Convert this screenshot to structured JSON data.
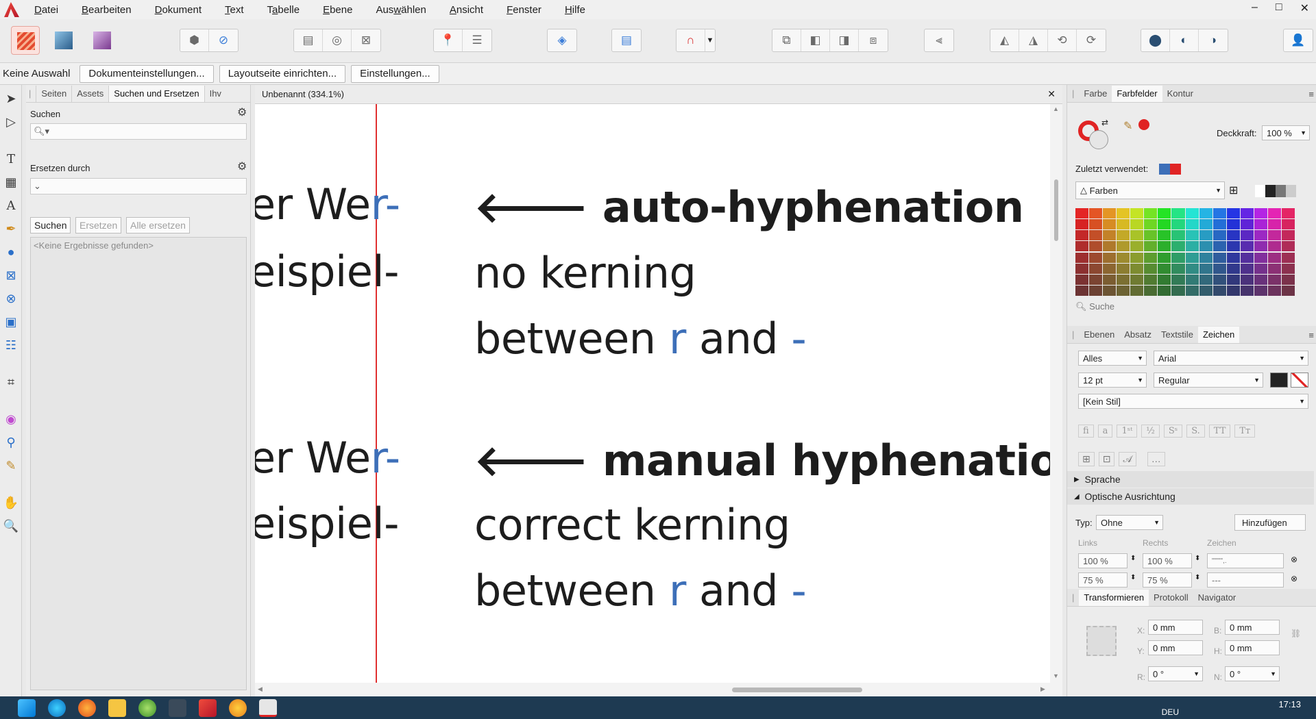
{
  "menubar": {
    "items": [
      {
        "pre": "",
        "u": "D",
        "post": "atei"
      },
      {
        "pre": "",
        "u": "B",
        "post": "earbeiten"
      },
      {
        "pre": "",
        "u": "D",
        "post": "okument"
      },
      {
        "pre": "",
        "u": "T",
        "post": "ext"
      },
      {
        "pre": "T",
        "u": "a",
        "post": "belle"
      },
      {
        "pre": "",
        "u": "E",
        "post": "bene"
      },
      {
        "pre": "Aus",
        "u": "w",
        "post": "ählen"
      },
      {
        "pre": "",
        "u": "A",
        "post": "nsicht"
      },
      {
        "pre": "",
        "u": "F",
        "post": "enster"
      },
      {
        "pre": "",
        "u": "H",
        "post": "ilfe"
      }
    ],
    "min": "–",
    "max": "□",
    "close": "✕"
  },
  "context": {
    "label": "Keine Auswahl",
    "buttons": [
      "Dokumenteinstellungen...",
      "Layoutseite einrichten...",
      "Einstellungen..."
    ]
  },
  "left_panel": {
    "tabs": [
      "Seiten",
      "Assets",
      "Suchen und Ersetzen",
      "Ihv"
    ],
    "search_label": "Suchen",
    "replace_label": "Ersetzen durch",
    "find_btn": "Suchen",
    "replace_btn": "Ersetzen",
    "replace_all_btn": "Alle ersetzen",
    "no_results": "<Keine Ergebnisse gefunden>"
  },
  "document": {
    "tab_title": "Unbenannt (334.1%)",
    "block1": {
      "left1": "er We",
      "left1_r": "r",
      "left1_h": "-",
      "left2": "eispiel-",
      "heading": "auto-hyphenation",
      "l2": "no kerning",
      "l3_a": "between ",
      "l3_r": "r",
      "l3_b": " and ",
      "l3_h": "-"
    },
    "block2": {
      "left1": "er We",
      "left1_r": "r",
      "left1_h": "-",
      "left2": "eispiel-",
      "heading": "manual hyphenation",
      "l2": "correct kerning",
      "l3_a": "between ",
      "l3_r": "r",
      "l3_b": " and ",
      "l3_h": "-"
    },
    "arrow": "🡐"
  },
  "right_panel": {
    "tabs1": [
      "Farbe",
      "Farbfelder",
      "Kontur"
    ],
    "opacity_label": "Deckkraft:",
    "opacity_value": "100 %",
    "recent_label": "Zuletzt verwendet:",
    "palette": "Farben",
    "swatch_search": "Suche",
    "tabs2": [
      "Ebenen",
      "Absatz",
      "Textstile",
      "Zeichen"
    ],
    "scope": "Alles",
    "font": "Arial",
    "size": "12 pt",
    "weight": "Regular",
    "style": "[Kein Stil]",
    "sec_sprache": "Sprache",
    "sec_optik": "Optische Ausrichtung",
    "typ_label": "Typ:",
    "typ_value": "Ohne",
    "add_btn": "Hinzufügen",
    "col_links": "Links",
    "col_rechts": "Rechts",
    "col_zeichen": "Zeichen",
    "row1_l": "100 %",
    "row1_r": "100 %",
    "row1_z": "\"\"\"'\",.",
    "row2_l": "75 %",
    "row2_r": "75 %",
    "row2_z": "---",
    "tabs3": [
      "Transformieren",
      "Protokoll",
      "Navigator"
    ],
    "x_label": "X:",
    "x_val": "0 mm",
    "y_label": "Y:",
    "y_val": "0 mm",
    "b_label": "B:",
    "b_val": "0 mm",
    "h_label": "H:",
    "h_val": "0 mm",
    "r_label": "R:",
    "r_val": "0 °",
    "n_label": "N:",
    "n_val": "0 °"
  },
  "taskbar": {
    "time": "17:13",
    "lang": "DEU"
  },
  "colors": {
    "accent": "#3d6fb8",
    "guide": "#e03030",
    "brand": "#d8273a"
  }
}
